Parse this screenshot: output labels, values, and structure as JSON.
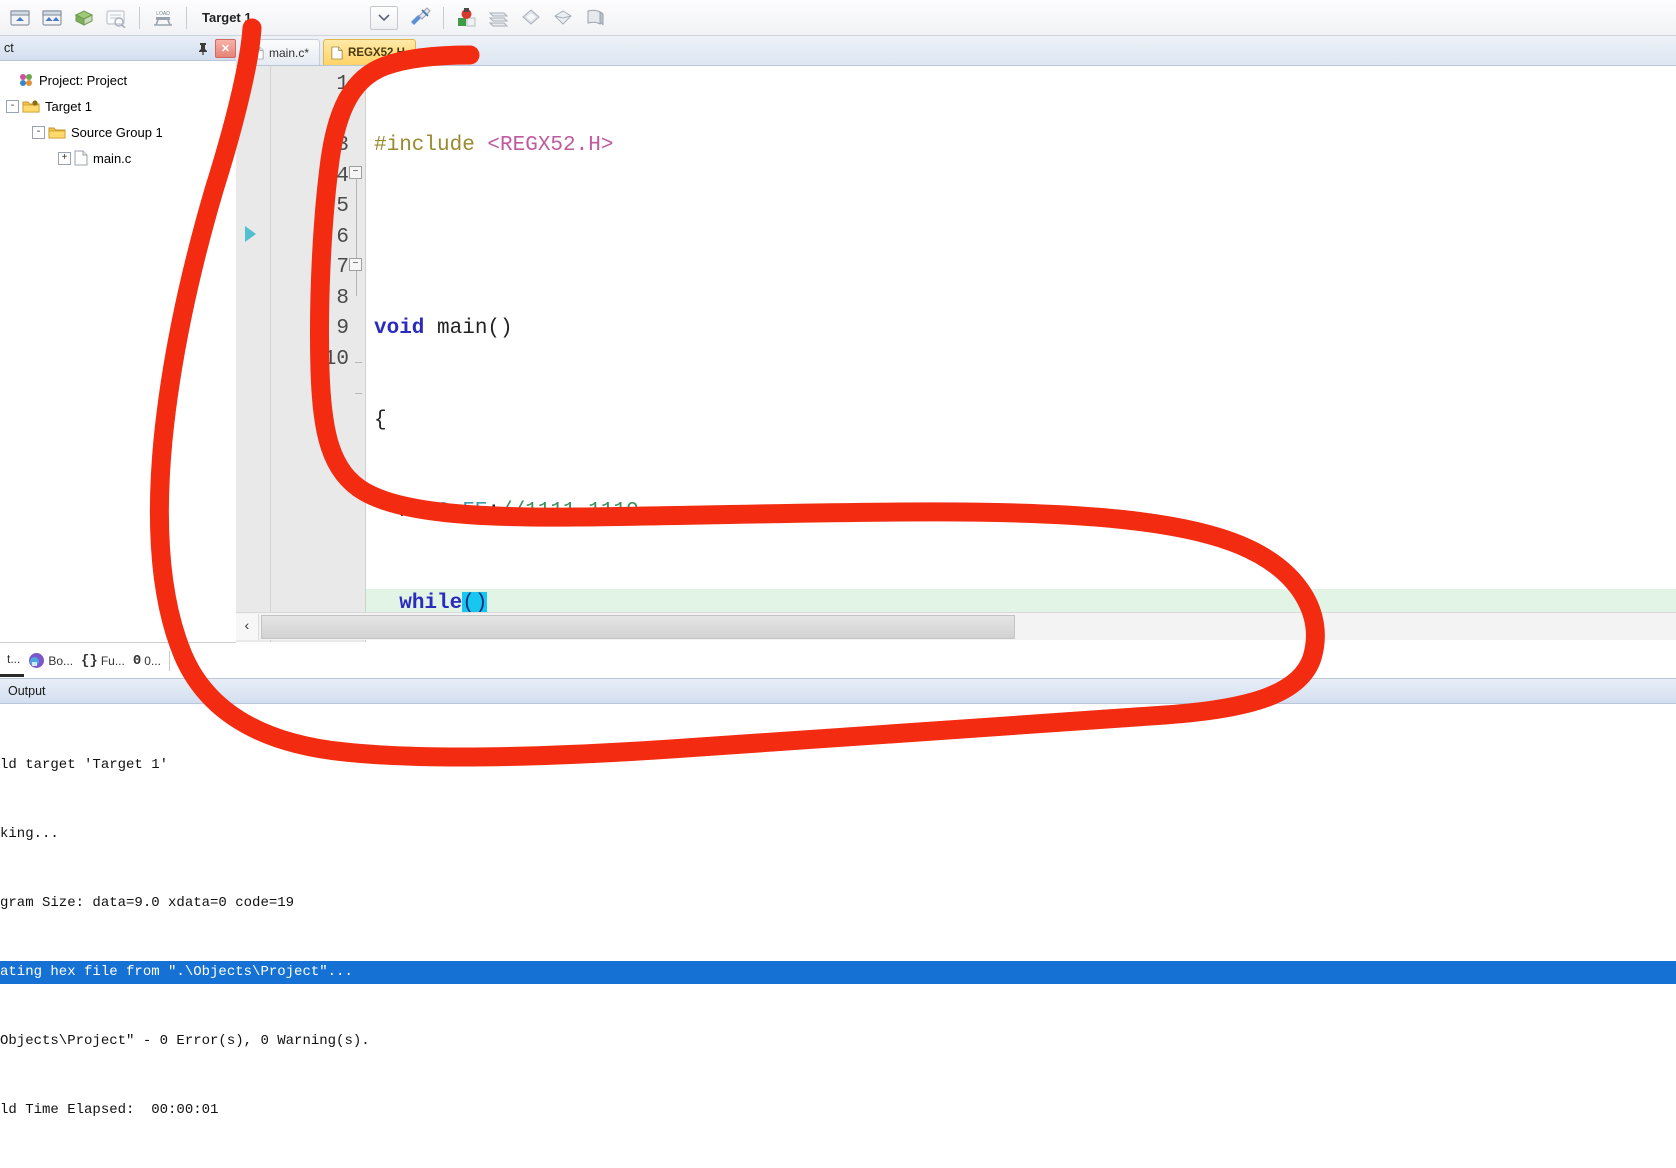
{
  "toolbar": {
    "icons": [
      {
        "name": "translate-icon",
        "title": "Translate"
      },
      {
        "name": "build-icon",
        "title": "Build"
      },
      {
        "name": "rebuild-icon",
        "title": "Rebuild"
      },
      {
        "name": "batch-build-icon",
        "title": "Batch Build"
      },
      {
        "name": "download-icon",
        "title": "Download"
      }
    ],
    "target_label": "Target 1",
    "combo_arrow": "⌄",
    "right_icons": [
      {
        "name": "options-target-icon",
        "title": "Options for Target"
      },
      {
        "name": "manage-project-items-icon",
        "title": "Manage Project Items"
      },
      {
        "name": "multi-project-icon",
        "title": "Multi-Project"
      },
      {
        "name": "pack-installer-icon",
        "title": "Pack Installer"
      },
      {
        "name": "configure-icon",
        "title": "Configure"
      },
      {
        "name": "books-icon",
        "title": "Books"
      }
    ]
  },
  "project_panel": {
    "header_title": "ct",
    "header_full_title": "Project",
    "pin_icon": "pin-icon",
    "close_icon": "close-icon",
    "tree": [
      {
        "label": "Project: Project",
        "depth": 0,
        "expander": "",
        "icon": "project-icon"
      },
      {
        "label": "Target 1",
        "depth": 1,
        "expander": "-",
        "icon": "folder-target-icon"
      },
      {
        "label": "Source Group 1",
        "depth": 2,
        "expander": "-",
        "icon": "folder-group-icon"
      },
      {
        "label": "main.c",
        "depth": 3,
        "expander": "+",
        "icon": "c-file-icon"
      }
    ]
  },
  "side_tabs": [
    {
      "label": "t...",
      "icon": "project-tab-icon",
      "active": true
    },
    {
      "label": "Bo...",
      "icon": "books-tab-icon",
      "active": false
    },
    {
      "label": "Fu...",
      "icon": "braces-icon",
      "active": false
    },
    {
      "label": "0...",
      "icon": "templates-icon",
      "active": false
    }
  ],
  "editor": {
    "tabs": [
      {
        "label": "main.c*",
        "active": false,
        "icon": "c-file-icon"
      },
      {
        "label": "REGX52.H",
        "active": true,
        "icon": "h-file-icon"
      }
    ],
    "line_numbers": [
      "1",
      "2",
      "3",
      "4",
      "5",
      "6",
      "7",
      "8",
      "9",
      "10"
    ],
    "code_lines": [
      {
        "n": "1",
        "tokens": [
          {
            "t": "#include ",
            "c": "k-pre"
          },
          {
            "t": "<REGX52.H>",
            "c": "k-inc"
          }
        ]
      },
      {
        "n": "2",
        "tokens": []
      },
      {
        "n": "3",
        "tokens": [
          {
            "t": "void",
            "c": "k-kw"
          },
          {
            "t": " main()",
            "c": "k-plain"
          }
        ]
      },
      {
        "n": "4",
        "tokens": [
          {
            "t": "{",
            "c": "k-plain"
          }
        ],
        "fold": "-"
      },
      {
        "n": "5",
        "tokens": [
          {
            "t": "  P2=",
            "c": "k-plain"
          },
          {
            "t": "0xFE",
            "c": "k-num"
          },
          {
            "t": ";",
            "c": "k-plain"
          },
          {
            "t": "//1111 1110",
            "c": "k-cmt"
          }
        ]
      },
      {
        "n": "6",
        "tokens": [
          {
            "t": "  ",
            "c": "k-plain"
          },
          {
            "t": "while",
            "c": "k-kw"
          },
          {
            "t": "()",
            "c": "sel"
          }
        ],
        "highlight": true
      },
      {
        "n": "7",
        "tokens": [
          {
            "t": "  {",
            "c": "k-plain"
          }
        ],
        "fold": "-"
      },
      {
        "n": "8",
        "tokens": []
      },
      {
        "n": "9",
        "tokens": [
          {
            "t": "  }",
            "c": "k-plain"
          }
        ],
        "foldend": true
      },
      {
        "n": "10",
        "tokens": [
          {
            "t": "}",
            "c": "k-plain"
          }
        ],
        "foldend": true
      }
    ],
    "hscroll_left_arrow": "‹"
  },
  "output": {
    "header_title": "Output",
    "lines": [
      {
        "text": "ld target 'Target 1'",
        "selected": false
      },
      {
        "text": "king...",
        "selected": false
      },
      {
        "text": "gram Size: data=9.0 xdata=0 code=19",
        "selected": false
      },
      {
        "text": "ating hex file from \".\\Objects\\Project\"...",
        "selected": true
      },
      {
        "text": "Objects\\Project\" - 0 Error(s), 0 Warning(s).",
        "selected": false
      },
      {
        "text": "ld Time Elapsed:  00:00:01",
        "selected": false
      }
    ]
  },
  "annotation": {
    "name": "red-circle-annotation",
    "color": "#f32b10",
    "stroke_width": 19
  }
}
